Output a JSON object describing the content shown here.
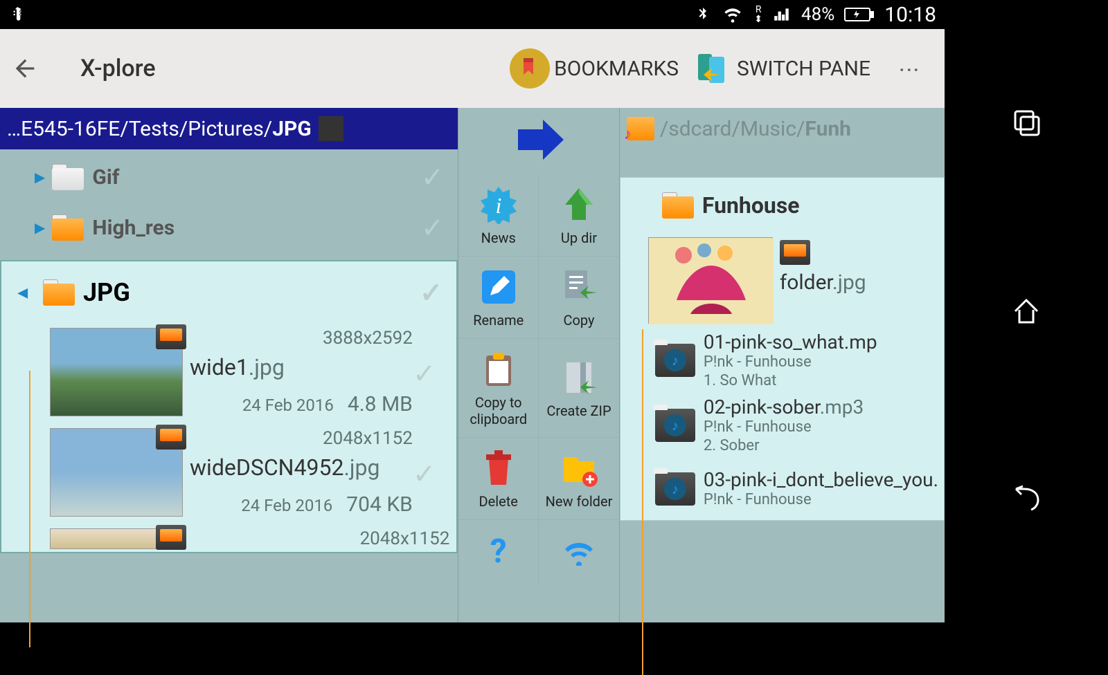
{
  "statusbar": {
    "battery_pct": "48%",
    "time": "10:18",
    "net_label": "R"
  },
  "toolbar": {
    "app_title": "X-plore",
    "bookmarks_label": "BOOKMARKS",
    "switch_pane_label": "SWITCH PANE"
  },
  "left_pane": {
    "path_prefix": "…E545-16FE/Tests/Pictures/",
    "path_current": "JPG",
    "folders": [
      {
        "name": "Gif"
      },
      {
        "name": "High_res"
      }
    ],
    "selected_folder": "JPG",
    "files": [
      {
        "name": "wide1",
        "ext": ".jpg",
        "dim": "3888x2592",
        "date": "24 Feb 2016",
        "size": "4.8 MB"
      },
      {
        "name": "wideDSCN4952",
        "ext": ".jpg",
        "dim": "2048x1152",
        "date": "24 Feb 2016",
        "size": "704 KB"
      },
      {
        "name": "",
        "ext": "",
        "dim": "2048x1152",
        "date": "",
        "size": ""
      }
    ]
  },
  "middle_actions": [
    {
      "label": "News"
    },
    {
      "label": "Up dir"
    },
    {
      "label": "Rename"
    },
    {
      "label": "Copy"
    },
    {
      "label": "Copy to clipboard"
    },
    {
      "label": "Create ZIP"
    },
    {
      "label": "Delete"
    },
    {
      "label": "New folder"
    }
  ],
  "right_pane": {
    "path": "/sdcard/Music/",
    "path_current": "Funh",
    "folder_name": "Funhouse",
    "folder_file": {
      "name": "folder",
      "ext": ".jpg"
    },
    "audio": [
      {
        "title": "01-pink-so_what.mp",
        "album": "P!nk - Funhouse",
        "track": "1.  So What"
      },
      {
        "title": "02-pink-sober",
        "ext": ".mp3",
        "album": "P!nk - Funhouse",
        "track": "2.  Sober"
      },
      {
        "title": "03-pink-i_dont_believe_you.",
        "album": "P!nk - Funhouse",
        "track": ""
      }
    ]
  }
}
